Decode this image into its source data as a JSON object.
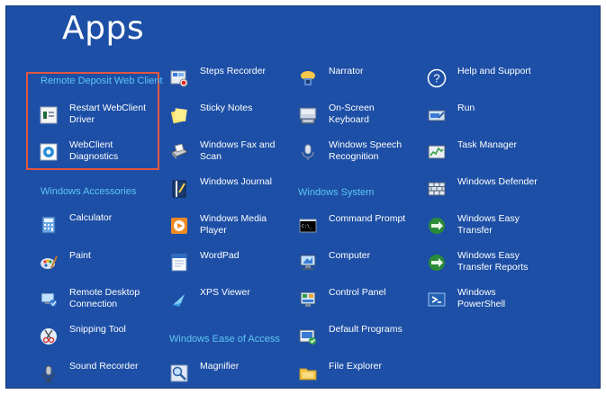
{
  "title": "Apps",
  "groups": {
    "remote_deposit": "Remote Deposit Web Client",
    "accessories": "Windows Accessories",
    "system": "Windows System",
    "ease": "Windows Ease of Access"
  },
  "apps": {
    "restart_webclient": "Restart WebClient\nDriver",
    "webclient_diag": "WebClient\nDiagnostics",
    "calculator": "Calculator",
    "paint": "Paint",
    "remote_desktop": "Remote Desktop\nConnection",
    "snipping": "Snipping Tool",
    "sound_recorder": "Sound Recorder",
    "steps_recorder": "Steps Recorder",
    "sticky_notes": "Sticky Notes",
    "fax_scan": "Windows Fax and\nScan",
    "journal": "Windows Journal",
    "media_player": "Windows Media\nPlayer",
    "wordpad": "WordPad",
    "xps_viewer": "XPS Viewer",
    "magnifier": "Magnifier",
    "narrator": "Narrator",
    "osk": "On-Screen\nKeyboard",
    "speech": "Windows Speech\nRecognition",
    "cmd": "Command Prompt",
    "computer": "Computer",
    "control_panel": "Control Panel",
    "default_programs": "Default Programs",
    "explorer": "File Explorer",
    "help": "Help and Support",
    "run": "Run",
    "task_manager": "Task Manager",
    "defender": "Windows Defender",
    "easy_transfer": "Windows Easy\nTransfer",
    "easy_transfer_reports": "Windows Easy\nTransfer Reports",
    "powershell": "Windows\nPowerShell"
  }
}
